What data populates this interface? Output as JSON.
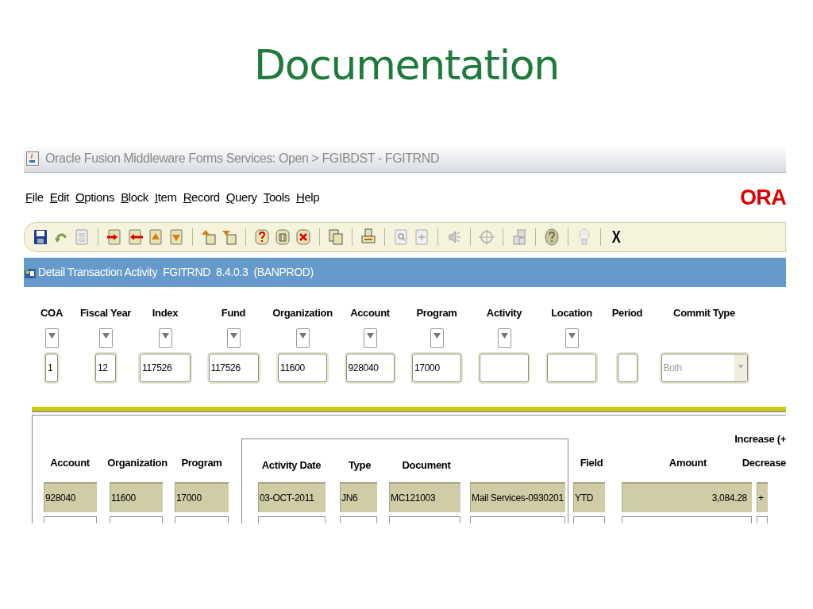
{
  "slide_title": "Documentation",
  "window": {
    "title": "Oracle Fusion Middleware Forms Services:  Open > FGIBDST - FGITRND"
  },
  "menu": [
    "File",
    "Edit",
    "Options",
    "Block",
    "Item",
    "Record",
    "Query",
    "Tools",
    "Help"
  ],
  "logo_text": "ORA",
  "toolbar": {
    "close_label": "X"
  },
  "form_title": "Detail Transaction Activity  FGITRND  8.4.0.3  (BANPROD)",
  "key_block": {
    "fields": [
      {
        "label": "COA",
        "value": "1",
        "kind": "lookup"
      },
      {
        "label": "Fiscal Year",
        "value": "12",
        "kind": "lookup"
      },
      {
        "label": "Index",
        "value": "117526",
        "kind": "lookup"
      },
      {
        "label": "Fund",
        "value": "117526",
        "kind": "lookup"
      },
      {
        "label": "Organization",
        "value": "11600",
        "kind": "lookup"
      },
      {
        "label": "Account",
        "value": "928040",
        "kind": "lookup"
      },
      {
        "label": "Program",
        "value": "17000",
        "kind": "lookup"
      },
      {
        "label": "Activity",
        "kind": "lookup"
      },
      {
        "label": "Location",
        "kind": "lookup"
      },
      {
        "label": "Period",
        "kind": "text"
      },
      {
        "label": "Commit Type",
        "value": "Both",
        "kind": "select"
      }
    ]
  },
  "detail": {
    "columns": [
      {
        "header": "Account"
      },
      {
        "header": "Organization"
      },
      {
        "header": "Program"
      },
      {
        "header": "Activity Date"
      },
      {
        "header": "Type"
      },
      {
        "header": "Document"
      },
      {},
      {
        "header": "Field"
      },
      {
        "header": "Amount"
      },
      {
        "header": "Increase (+",
        "header_2": "Decrease"
      }
    ],
    "rows": [
      {
        "cells": [
          "928040",
          "11600",
          "17000",
          "03-OCT-2011",
          "JN6",
          "MC121003",
          "Mail Services-0930201",
          "YTD",
          "3,084.28",
          "+"
        ]
      }
    ]
  }
}
